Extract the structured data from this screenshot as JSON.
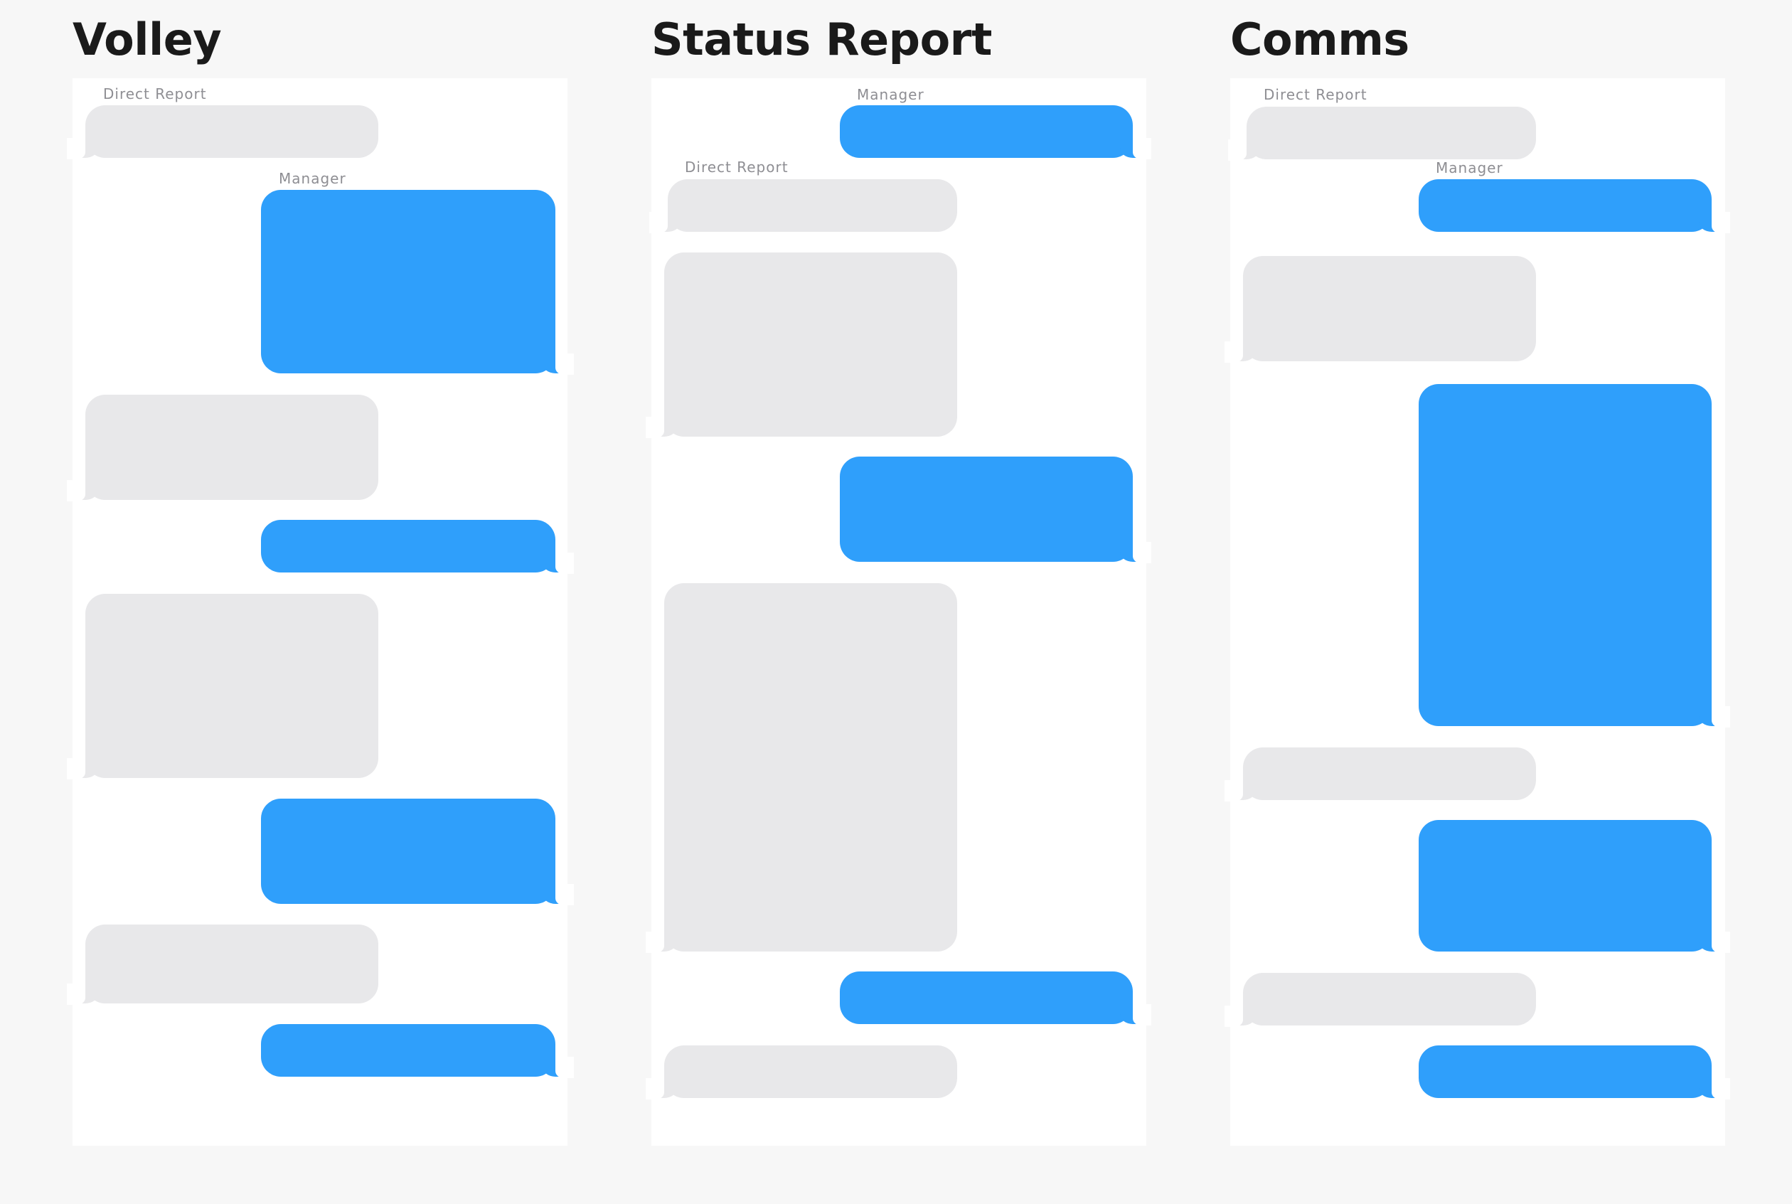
{
  "columns": [
    {
      "title": "Volley",
      "labels": {
        "direct_report": "Direct Report",
        "manager": "Manager"
      },
      "messages": [
        "direct_report",
        "manager",
        "direct_report",
        "manager",
        "direct_report",
        "manager",
        "direct_report",
        "manager"
      ]
    },
    {
      "title": "Status Report",
      "labels": {
        "manager": "Manager",
        "direct_report": "Direct Report"
      },
      "messages": [
        "manager",
        "direct_report",
        "direct_report",
        "manager",
        "direct_report",
        "manager",
        "direct_report"
      ]
    },
    {
      "title": "Comms",
      "labels": {
        "direct_report": "Direct Report",
        "manager": "Manager"
      },
      "messages": [
        "direct_report",
        "manager",
        "direct_report",
        "manager",
        "direct_report",
        "manager",
        "direct_report",
        "manager"
      ]
    }
  ],
  "colors": {
    "page_background": "#f7f7f7",
    "panel_background": "#ffffff",
    "manager_bubble": "#2f9ffb",
    "direct_report_bubble": "#e8e8ea",
    "sender_label": "#8e8e93",
    "title": "#1a1a1a"
  }
}
